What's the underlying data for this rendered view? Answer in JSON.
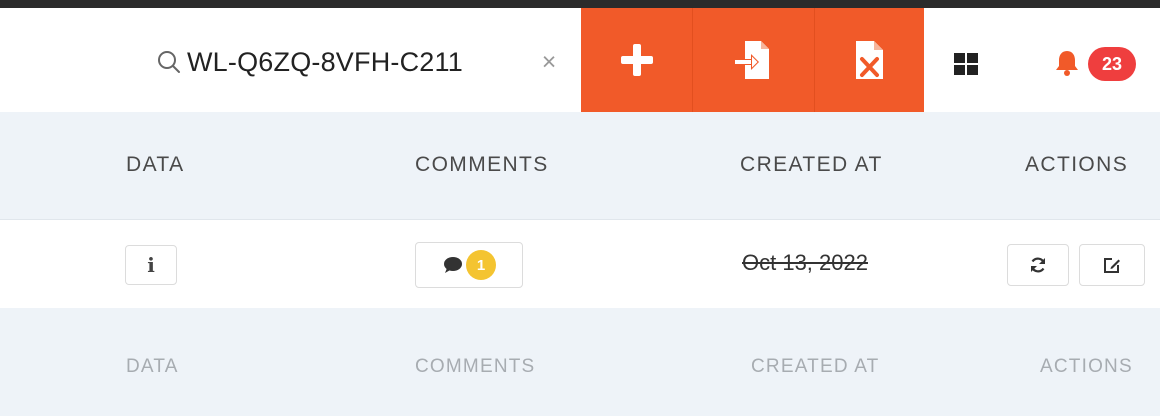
{
  "search": {
    "value": "WL-Q6ZQ-8VFH-C211",
    "clear_label": "×"
  },
  "toolbar": {
    "add_icon": "plus-icon",
    "import_icon": "file-import-icon",
    "export_icon": "file-excel-icon",
    "accent_color": "#f15a29"
  },
  "header": {
    "apps_icon": "grid-icon",
    "notifications": {
      "icon": "bell-icon",
      "count": "23",
      "badge_color": "#ef3e3e"
    }
  },
  "table": {
    "columns": [
      "DATA",
      "COMMENTS",
      "CREATED AT",
      "ACTIONS"
    ],
    "rows": [
      {
        "data_button": "i",
        "comment_count": "1",
        "created_at": "Oct 13, 2022",
        "actions": [
          "refresh-icon",
          "edit-icon"
        ]
      }
    ],
    "footer_columns": [
      "DATA",
      "COMMENTS",
      "CREATED AT",
      "ACTIONS"
    ]
  }
}
